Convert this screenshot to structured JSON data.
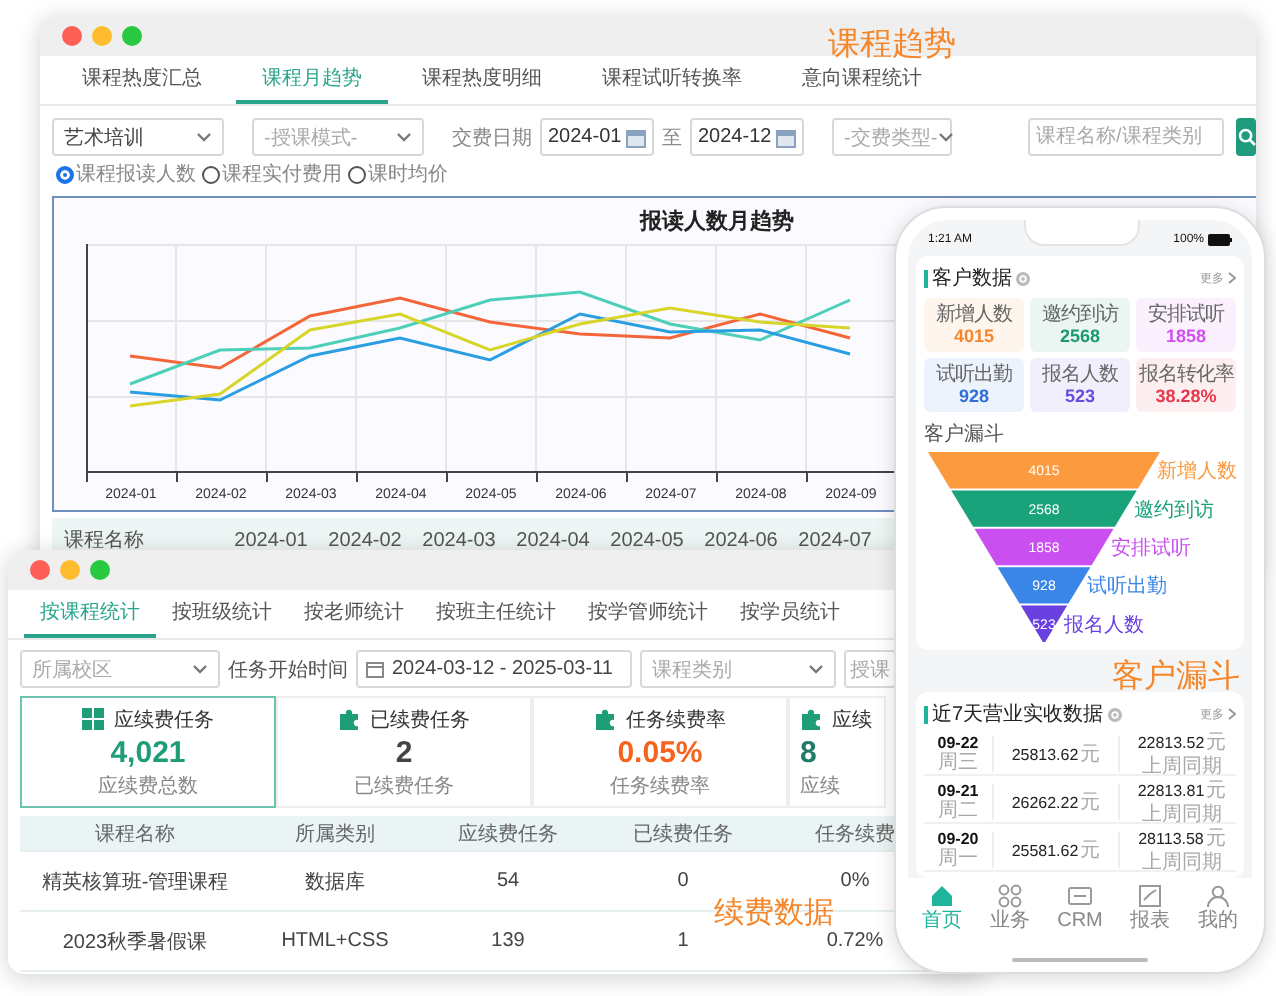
{
  "callouts": [
    {
      "text": "课程趋势"
    },
    {
      "text": "客户漏斗"
    },
    {
      "text": "续费数据"
    }
  ],
  "trend_window": {
    "tabs": [
      {
        "label": "课程热度汇总",
        "selected": false
      },
      {
        "label": "课程月趋势",
        "selected": true
      },
      {
        "label": "课程热度明细",
        "selected": false
      },
      {
        "label": "课程试听转换率",
        "selected": false
      },
      {
        "label": "意向课程统计",
        "selected": false
      }
    ],
    "filters": {
      "course_type": {
        "value": "艺术培训"
      },
      "teaching_mode": {
        "placeholder": "-授课模式-"
      },
      "date_label": "交费日期",
      "date_from": "2024-01",
      "date_separator": "至",
      "date_to": "2024-12",
      "payment_type": {
        "placeholder": "-交费类型-"
      },
      "search": {
        "placeholder": "课程名称/课程类别"
      }
    },
    "metrics": [
      {
        "label": "课程报读人数",
        "selected": true
      },
      {
        "label": "课程实付费用",
        "selected": false
      },
      {
        "label": "课时均价",
        "selected": false
      }
    ],
    "chart": {
      "title": "报读人数月趋势",
      "x_labels": [
        "2024-01",
        "2024-02",
        "2024-03",
        "2024-04",
        "2024-05",
        "2024-06",
        "2024-07",
        "2024-08",
        "2024-09"
      ]
    },
    "table": {
      "columns": [
        "课程名称",
        "2024-01",
        "2024-02",
        "2024-03",
        "2024-04",
        "2024-05",
        "2024-06",
        "2024-07"
      ]
    }
  },
  "renewal_window": {
    "tabs": [
      {
        "label": "按课程统计",
        "selected": true
      },
      {
        "label": "按班级统计",
        "selected": false
      },
      {
        "label": "按老师统计",
        "selected": false
      },
      {
        "label": "按班主任统计",
        "selected": false
      },
      {
        "label": "按学管师统计",
        "selected": false
      },
      {
        "label": "按学员统计",
        "selected": false
      }
    ],
    "filters": {
      "campus": {
        "placeholder": "所属校区"
      },
      "start_label": "任务开始时间",
      "date_range": "2024-03-12 - 2025-03-11",
      "category": {
        "placeholder": "课程类别"
      },
      "teaching": {
        "placeholder": "授课"
      }
    },
    "stats": [
      {
        "title": "应续费任务",
        "value": "4,021",
        "caption": "应续费总数",
        "color": "#1f9c78",
        "selected": true
      },
      {
        "title": "已续费任务",
        "value": "2",
        "caption": "已续费任务",
        "color": "#444444",
        "selected": false
      },
      {
        "title": "任务续费率",
        "value": "0.05%",
        "caption": "任务续费率",
        "color": "#f5631e",
        "selected": false
      },
      {
        "title": "应续",
        "value": "8",
        "caption": "应续",
        "color": "#1f7c68",
        "selected": false
      }
    ],
    "table": {
      "columns": [
        "课程名称",
        "所属类别",
        "应续费任务",
        "已续费任务",
        "任务续费"
      ],
      "rows": [
        [
          "精英核算班-管理课程",
          "数据库",
          "54",
          "0",
          "0%"
        ],
        [
          "2023秋季暑假课",
          "HTML+CSS",
          "139",
          "1",
          "0.72%"
        ]
      ]
    }
  },
  "phone": {
    "status": {
      "time": "1:21 AM",
      "battery": "100%"
    },
    "customer_data": {
      "title": "客户数据",
      "more": "更多",
      "cards": [
        {
          "label": "新增人数",
          "value": "4015",
          "color": "#f5862a"
        },
        {
          "label": "邀约到访",
          "value": "2568",
          "color": "#1a9a6c"
        },
        {
          "label": "安排试听",
          "value": "1858",
          "color": "#d24ff0"
        },
        {
          "label": "试听出勤",
          "value": "928",
          "color": "#2f6fd8"
        },
        {
          "label": "报名人数",
          "value": "523",
          "color": "#6a4be0"
        },
        {
          "label": "报名转化率",
          "value": "38.28%",
          "color": "#e8384f"
        }
      ]
    },
    "funnel": {
      "title": "客户漏斗",
      "stages": [
        {
          "value": "4015",
          "label": "新增人数",
          "color": "#fb9a3f"
        },
        {
          "value": "2568",
          "label": "邀约到访",
          "color": "#1aa37a"
        },
        {
          "value": "1858",
          "label": "安排试听",
          "color": "#c94ff0"
        },
        {
          "value": "928",
          "label": "试听出勤",
          "color": "#3a86e8"
        },
        {
          "value": "523",
          "label": "报名人数",
          "color": "#6a40e0"
        }
      ]
    },
    "revenue": {
      "title": "近7天营业实收数据",
      "more": "更多",
      "rows": [
        {
          "date": "09-22",
          "weekday": "周三",
          "amount": "25813.62",
          "unit": "元",
          "compare": "22813.52",
          "compare_unit": "元",
          "compare_label": "上周同期"
        },
        {
          "date": "09-21",
          "weekday": "周二",
          "amount": "26262.22",
          "unit": "元",
          "compare": "22813.81",
          "compare_unit": "元",
          "compare_label": "上周同期"
        },
        {
          "date": "09-20",
          "weekday": "周一",
          "amount": "25581.62",
          "unit": "元",
          "compare": "28113.58",
          "compare_unit": "元",
          "compare_label": "上周同期"
        }
      ]
    },
    "tab_bar": [
      {
        "label": "首页",
        "selected": true
      },
      {
        "label": "业务",
        "selected": false
      },
      {
        "label": "CRM",
        "selected": false
      },
      {
        "label": "报表",
        "selected": false
      },
      {
        "label": "我的",
        "selected": false
      }
    ]
  }
}
